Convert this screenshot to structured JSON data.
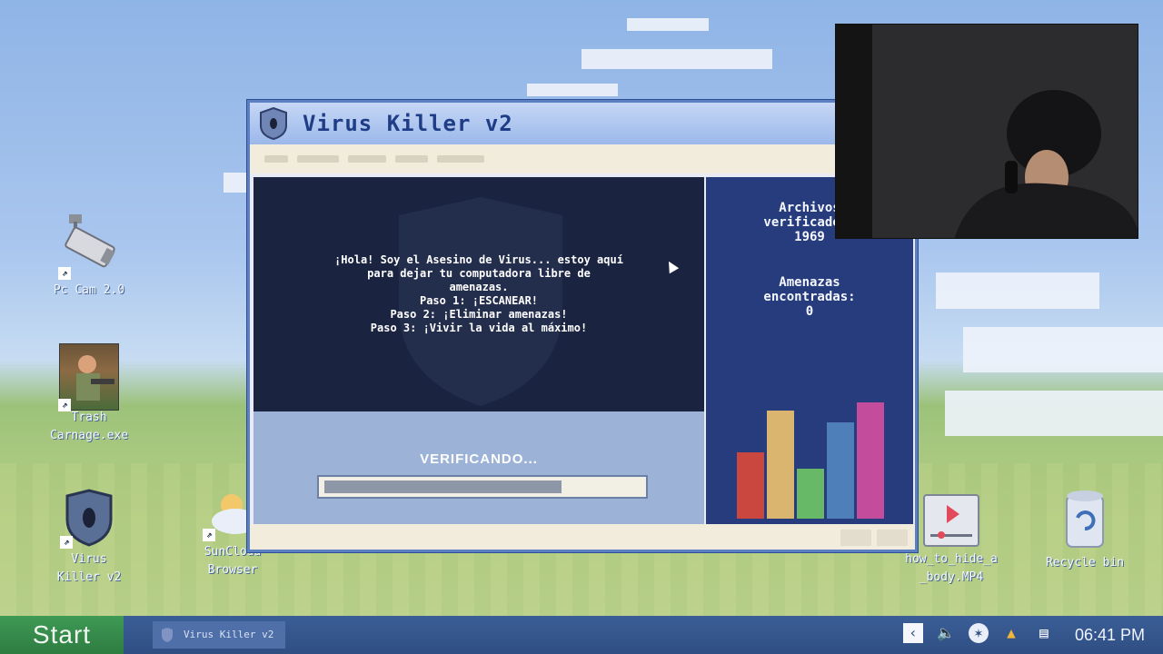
{
  "desktop": {
    "icons": [
      {
        "label": "Pc Cam 2.0",
        "icon": "security-camera-icon"
      },
      {
        "label": "Trash\nCarnage.exe",
        "icon": "game-cover-icon"
      },
      {
        "label": "Virus\nKiller v2",
        "icon": "shield-icon"
      },
      {
        "label": "SunCloud\nBrowser",
        "icon": "cloud-sun-icon"
      },
      {
        "label": "how_to_hide_a\n_body.MP4",
        "icon": "video-file-icon"
      },
      {
        "label": "Recycle bin",
        "icon": "recycle-bin-icon"
      }
    ]
  },
  "window": {
    "title": "Virus Killer v2",
    "intro_lines": [
      "¡Hola! Soy el Asesino de Virus... estoy aquí",
      "para dejar tu computadora libre de",
      "amenazas.",
      "Paso 1: ¡ESCANEAR!",
      "Paso 2: ¡Eliminar amenazas!",
      "Paso 3: ¡Vivir la vida al máximo!"
    ],
    "status_label": "VERIFICANDO...",
    "progress": 0.75,
    "files_label_1": "Archivos",
    "files_label_2": "verificados:",
    "files_value": "1969",
    "threats_label_1": "Amenazas",
    "threats_label_2": "encontradas:",
    "threats_value": "0",
    "chart_colors": [
      "#c9473f",
      "#d9b56f",
      "#67b968",
      "#4f7fb8",
      "#c34d9c"
    ],
    "chart_levels": [
      0.57,
      0.93,
      0.43,
      0.83,
      1.0
    ]
  },
  "taskbar": {
    "start_label": "Start",
    "task_label": "Virus Killer v2",
    "clock": "06:41 PM",
    "tray_icons": [
      "chevron-left-icon",
      "speaker-icon",
      "network-globe-icon",
      "warning-icon",
      "folder-icon"
    ]
  }
}
